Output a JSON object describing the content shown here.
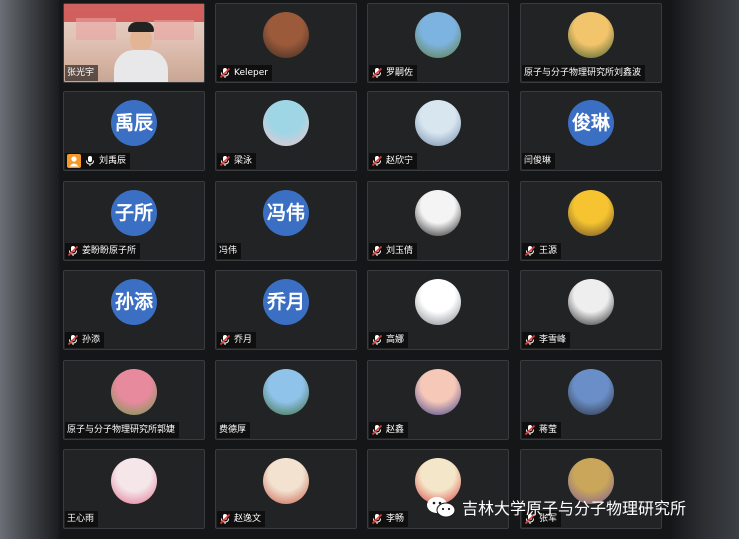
{
  "participants": [
    {
      "name": "张光宇",
      "avatar": "video",
      "mic": "none"
    },
    {
      "name": "Keleper",
      "avatar": "photo",
      "mic": "muted",
      "colors": [
        "#9b5a3a",
        "#3a2a22"
      ]
    },
    {
      "name": "罗嗣佐",
      "avatar": "photo",
      "mic": "muted",
      "colors": [
        "#7db3e0",
        "#5d7a3a"
      ]
    },
    {
      "name": "原子与分子物理研究所刘鑫波",
      "avatar": "photo",
      "mic": "none",
      "colors": [
        "#f2c46b",
        "#3f5a2a"
      ]
    },
    {
      "name": "刘禹辰",
      "avatar": "text",
      "avatar_text": "禹辰",
      "mic": "on",
      "extra_icon": "person-icon"
    },
    {
      "name": "梁泳",
      "avatar": "photo",
      "mic": "muted",
      "colors": [
        "#9fd6e6",
        "#f3c6cc"
      ]
    },
    {
      "name": "赵欣宁",
      "avatar": "photo",
      "mic": "muted",
      "colors": [
        "#d8e6f0",
        "#6f8aa6"
      ]
    },
    {
      "name": "闫俊琳",
      "avatar": "text",
      "avatar_text": "俊琳",
      "mic": "none"
    },
    {
      "name": "姜盼盼原子所",
      "avatar": "text",
      "avatar_text": "子所",
      "mic": "muted"
    },
    {
      "name": "冯伟",
      "avatar": "text",
      "avatar_text": "冯伟",
      "mic": "none"
    },
    {
      "name": "刘玉倩",
      "avatar": "photo",
      "mic": "muted",
      "colors": [
        "#f4f4f4",
        "#1a1a1a"
      ]
    },
    {
      "name": "王源",
      "avatar": "photo",
      "mic": "muted",
      "colors": [
        "#f5c430",
        "#6b4a2a"
      ]
    },
    {
      "name": "孙添",
      "avatar": "text",
      "avatar_text": "孙添",
      "mic": "muted"
    },
    {
      "name": "乔月",
      "avatar": "text",
      "avatar_text": "乔月",
      "mic": "muted"
    },
    {
      "name": "高娜",
      "avatar": "photo",
      "mic": "muted",
      "colors": [
        "#ffffff",
        "#7a7f86"
      ]
    },
    {
      "name": "李雪峰",
      "avatar": "photo",
      "mic": "muted",
      "colors": [
        "#eeeeee",
        "#222222"
      ]
    },
    {
      "name": "原子与分子物理研究所郭婕",
      "avatar": "photo",
      "mic": "none",
      "colors": [
        "#e88a9e",
        "#6b9a4a"
      ]
    },
    {
      "name": "费德厚",
      "avatar": "photo",
      "mic": "none",
      "colors": [
        "#8fc3ea",
        "#3f6a3a"
      ]
    },
    {
      "name": "赵鑫",
      "avatar": "photo",
      "mic": "muted",
      "colors": [
        "#f6c8b8",
        "#3a3f8a"
      ]
    },
    {
      "name": "蒋莹",
      "avatar": "photo",
      "mic": "muted",
      "colors": [
        "#6a8fc8",
        "#2a2f3a"
      ]
    },
    {
      "name": "王心雨",
      "avatar": "photo",
      "mic": "none",
      "colors": [
        "#f5e6ea",
        "#e07090"
      ]
    },
    {
      "name": "赵逸文",
      "avatar": "photo",
      "mic": "muted",
      "colors": [
        "#f2e2cf",
        "#c85a4a"
      ]
    },
    {
      "name": "李畅",
      "avatar": "photo",
      "mic": "muted",
      "colors": [
        "#f4e6c8",
        "#d63a3a"
      ]
    },
    {
      "name": "张军",
      "avatar": "photo",
      "mic": "muted",
      "colors": [
        "#c9a65a",
        "#7a5a9a"
      ]
    }
  ],
  "watermark": {
    "icon": "wechat-icon",
    "text": "吉林大学原子与分子物理研究所"
  }
}
